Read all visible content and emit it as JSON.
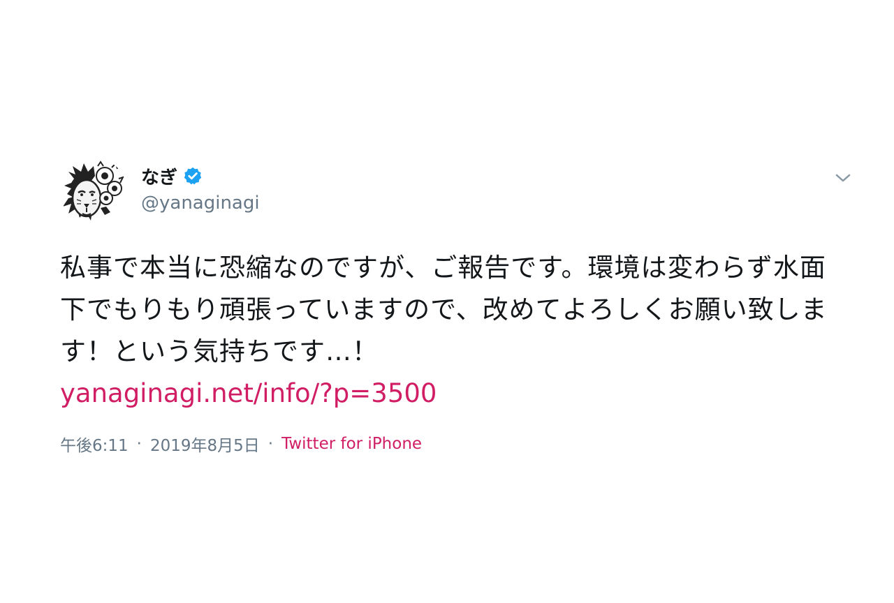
{
  "user": {
    "display_name": "なぎ",
    "handle": "@yanaginagi",
    "verified_icon": "verified-badge-icon",
    "avatar_icon": "lion-with-flowers-avatar"
  },
  "tweet": {
    "text": "私事で本当に恐縮なのですが、ご報告です。環境は変わらず水面下でもりもり頑張っていますので、改めてよろしくお願い致します！という気持ちです…！",
    "link": "yanaginagi.net/info/?p=3500",
    "time": "午後6:11",
    "date": "2019年8月5日",
    "source": "Twitter for iPhone",
    "separator": "·"
  },
  "icons": {
    "menu": "chevron-down-icon"
  },
  "colors": {
    "link": "#d11d64",
    "secondary_text": "#657786",
    "verified": "#1da1f2",
    "primary_text": "#14171a"
  }
}
